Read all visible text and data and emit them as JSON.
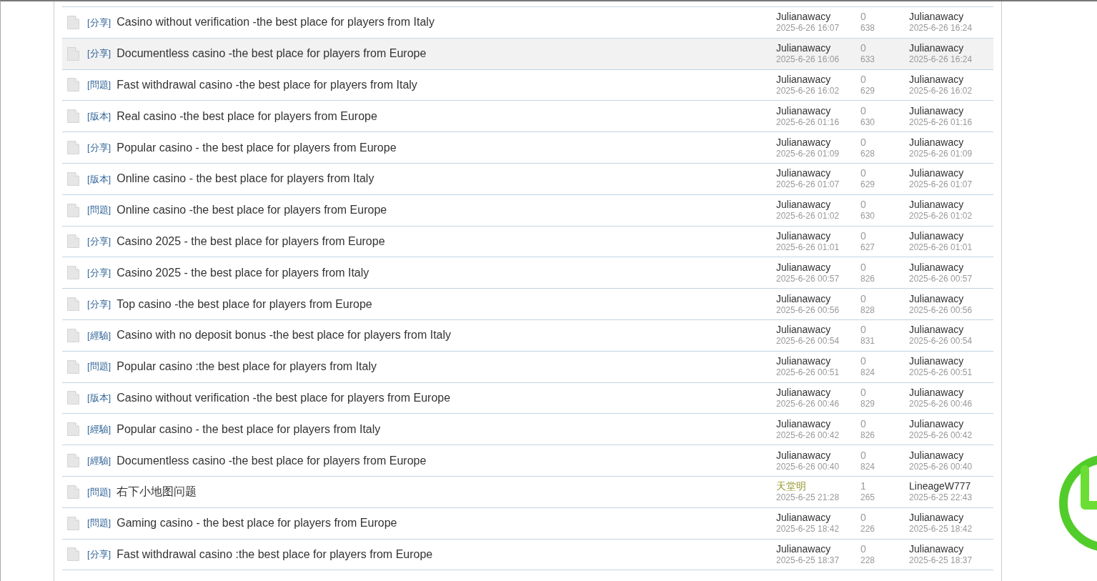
{
  "threads": [
    {
      "tag": "[分享]",
      "title": "Casino without verification -the best place for players from Italy",
      "author": {
        "name": "Julianawacy",
        "color": "#333333"
      },
      "posted": "2025-6-26 16:07",
      "replies": "0",
      "views": "638",
      "last_poster": "Julianawacy",
      "last_time": "2025-6-26 16:24",
      "highlighted": false
    },
    {
      "tag": "[分享]",
      "title": "Documentless casino -the best place for players from Europe",
      "author": {
        "name": "Julianawacy",
        "color": "#333333"
      },
      "posted": "2025-6-26 16:06",
      "replies": "0",
      "views": "633",
      "last_poster": "Julianawacy",
      "last_time": "2025-6-26 16:24",
      "highlighted": true
    },
    {
      "tag": "[問題]",
      "title": "Fast withdrawal casino -the best place for players from Italy",
      "author": {
        "name": "Julianawacy",
        "color": "#333333"
      },
      "posted": "2025-6-26 16:02",
      "replies": "0",
      "views": "629",
      "last_poster": "Julianawacy",
      "last_time": "2025-6-26 16:02",
      "highlighted": false
    },
    {
      "tag": "[版本]",
      "title": "Real casino -the best place for players from Europe",
      "author": {
        "name": "Julianawacy",
        "color": "#333333"
      },
      "posted": "2025-6-26 01:16",
      "replies": "0",
      "views": "630",
      "last_poster": "Julianawacy",
      "last_time": "2025-6-26 01:16",
      "highlighted": false
    },
    {
      "tag": "[分享]",
      "title": "Popular casino - the best place for players from Europe",
      "author": {
        "name": "Julianawacy",
        "color": "#333333"
      },
      "posted": "2025-6-26 01:09",
      "replies": "0",
      "views": "628",
      "last_poster": "Julianawacy",
      "last_time": "2025-6-26 01:09",
      "highlighted": false
    },
    {
      "tag": "[版本]",
      "title": "Online casino - the best place for players from Italy",
      "author": {
        "name": "Julianawacy",
        "color": "#333333"
      },
      "posted": "2025-6-26 01:07",
      "replies": "0",
      "views": "629",
      "last_poster": "Julianawacy",
      "last_time": "2025-6-26 01:07",
      "highlighted": false
    },
    {
      "tag": "[問題]",
      "title": "Online casino -the best place for players from Europe",
      "author": {
        "name": "Julianawacy",
        "color": "#333333"
      },
      "posted": "2025-6-26 01:02",
      "replies": "0",
      "views": "630",
      "last_poster": "Julianawacy",
      "last_time": "2025-6-26 01:02",
      "highlighted": false
    },
    {
      "tag": "[分享]",
      "title": "Casino 2025 - the best place for players from Europe",
      "author": {
        "name": "Julianawacy",
        "color": "#333333"
      },
      "posted": "2025-6-26 01:01",
      "replies": "0",
      "views": "627",
      "last_poster": "Julianawacy",
      "last_time": "2025-6-26 01:01",
      "highlighted": false
    },
    {
      "tag": "[分享]",
      "title": "Casino 2025 - the best place for players from Italy",
      "author": {
        "name": "Julianawacy",
        "color": "#333333"
      },
      "posted": "2025-6-26 00:57",
      "replies": "0",
      "views": "826",
      "last_poster": "Julianawacy",
      "last_time": "2025-6-26 00:57",
      "highlighted": false
    },
    {
      "tag": "[分享]",
      "title": "Top casino -the best place for players from Europe",
      "author": {
        "name": "Julianawacy",
        "color": "#333333"
      },
      "posted": "2025-6-26 00:56",
      "replies": "0",
      "views": "828",
      "last_poster": "Julianawacy",
      "last_time": "2025-6-26 00:56",
      "highlighted": false
    },
    {
      "tag": "[經驗]",
      "title": "Casino with no deposit bonus -the best place for players from Italy",
      "author": {
        "name": "Julianawacy",
        "color": "#333333"
      },
      "posted": "2025-6-26 00:54",
      "replies": "0",
      "views": "831",
      "last_poster": "Julianawacy",
      "last_time": "2025-6-26 00:54",
      "highlighted": false
    },
    {
      "tag": "[問題]",
      "title": "Popular casino :the best place for players from Italy",
      "author": {
        "name": "Julianawacy",
        "color": "#333333"
      },
      "posted": "2025-6-26 00:51",
      "replies": "0",
      "views": "824",
      "last_poster": "Julianawacy",
      "last_time": "2025-6-26 00:51",
      "highlighted": false
    },
    {
      "tag": "[版本]",
      "title": "Casino without verification -the best place for players from Europe",
      "author": {
        "name": "Julianawacy",
        "color": "#333333"
      },
      "posted": "2025-6-26 00:46",
      "replies": "0",
      "views": "829",
      "last_poster": "Julianawacy",
      "last_time": "2025-6-26 00:46",
      "highlighted": false
    },
    {
      "tag": "[經驗]",
      "title": "Popular casino - the best place for players from Italy",
      "author": {
        "name": "Julianawacy",
        "color": "#333333"
      },
      "posted": "2025-6-26 00:42",
      "replies": "0",
      "views": "826",
      "last_poster": "Julianawacy",
      "last_time": "2025-6-26 00:42",
      "highlighted": false
    },
    {
      "tag": "[經驗]",
      "title": "Documentless casino -the best place for players from Europe",
      "author": {
        "name": "Julianawacy",
        "color": "#333333"
      },
      "posted": "2025-6-26 00:40",
      "replies": "0",
      "views": "824",
      "last_poster": "Julianawacy",
      "last_time": "2025-6-26 00:40",
      "highlighted": false
    },
    {
      "tag": "[問題]",
      "title": "右下小地图问题",
      "author": {
        "name": "天堂明",
        "color": "#999933"
      },
      "posted": "2025-6-25 21:28",
      "replies": "1",
      "views": "265",
      "last_poster": "LineageW777",
      "last_time": "2025-6-25 22:43",
      "highlighted": false
    },
    {
      "tag": "[問題]",
      "title": "Gaming casino - the best place for players from Europe",
      "author": {
        "name": "Julianawacy",
        "color": "#333333"
      },
      "posted": "2025-6-25 18:42",
      "replies": "0",
      "views": "226",
      "last_poster": "Julianawacy",
      "last_time": "2025-6-25 18:42",
      "highlighted": false
    },
    {
      "tag": "[分享]",
      "title": "Fast withdrawal casino :the best place for players from Europe",
      "author": {
        "name": "Julianawacy",
        "color": "#333333"
      },
      "posted": "2025-6-25 18:37",
      "replies": "0",
      "views": "228",
      "last_poster": "Julianawacy",
      "last_time": "2025-6-25 18:37",
      "highlighted": false
    }
  ]
}
